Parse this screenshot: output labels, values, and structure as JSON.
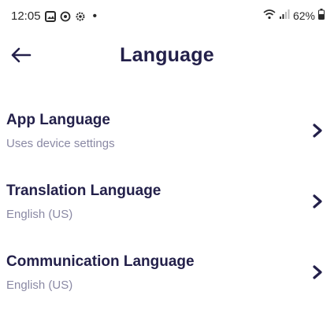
{
  "status_bar": {
    "time": "12:05",
    "dot": "•",
    "battery": "62%",
    "icons": [
      "image-icon",
      "sync-icon",
      "settings-icon",
      "wifi-icon",
      "signal-icon",
      "battery-icon"
    ]
  },
  "header": {
    "title": "Language",
    "back_icon": "arrow-left-icon"
  },
  "settings": [
    {
      "title": "App Language",
      "subtitle": "Uses device settings"
    },
    {
      "title": "Translation Language",
      "subtitle": "English (US)"
    },
    {
      "title": "Communication Language",
      "subtitle": "English (US)"
    }
  ],
  "colors": {
    "title": "#23204a",
    "subtitle": "#8a89a4",
    "background": "#ffffff"
  }
}
